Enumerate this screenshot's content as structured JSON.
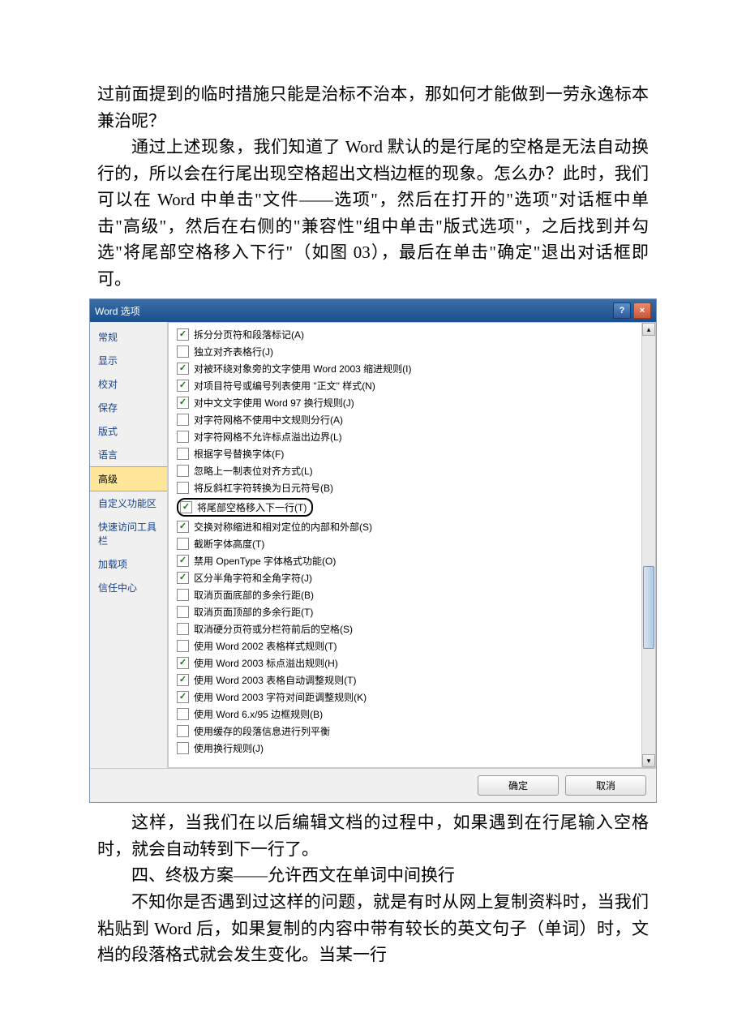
{
  "doc": {
    "para1": "过前面提到的临时措施只能是治标不治本，那如何才能做到一劳永逸标本兼治呢？",
    "para2": "通过上述现象，我们知道了 Word 默认的是行尾的空格是无法自动换行的，所以会在行尾出现空格超出文档边框的现象。怎么办？此时，我们可以在 Word 中单击\"文件——选项\"，然后在打开的\"选项\"对话框中单击\"高级\"，然后在右侧的\"兼容性\"组中单击\"版式选项\"，之后找到并勾选\"将尾部空格移入下行\"（如图 03），最后在单击\"确定\"退出对话框即可。",
    "para3": "这样，当我们在以后编辑文档的过程中，如果遇到在行尾输入空格时，就会自动转到下一行了。",
    "heading4": "四、终极方案——允许西文在单词中间换行",
    "para4": "不知你是否遇到过这样的问题，就是有时从网上复制资料时，当我们粘贴到 Word 后，如果复制的内容中带有较长的英文句子（单词）时，文档的段落格式就会发生变化。当某一行"
  },
  "dialog": {
    "title": "Word 选项",
    "help": "?",
    "close": "×",
    "sidebar": [
      "常规",
      "显示",
      "校对",
      "保存",
      "版式",
      "语言",
      "高级",
      "自定义功能区",
      "快速访问工具栏",
      "加载项",
      "信任中心"
    ],
    "selected_index": 6,
    "options": [
      {
        "checked": true,
        "label": "拆分分页符和段落标记(A)"
      },
      {
        "checked": false,
        "label": "独立对齐表格行(J)"
      },
      {
        "checked": true,
        "label": "对被环绕对象旁的文字使用 Word 2003 缩进规则(I)"
      },
      {
        "checked": true,
        "label": "对项目符号或编号列表使用 \"正文\" 样式(N)"
      },
      {
        "checked": true,
        "label": "对中文文字使用 Word 97 换行规则(J)"
      },
      {
        "checked": false,
        "label": "对字符网格不使用中文规则分行(A)"
      },
      {
        "checked": false,
        "label": "对字符网格不允许标点溢出边界(L)"
      },
      {
        "checked": false,
        "label": "根据字号替换字体(F)"
      },
      {
        "checked": false,
        "label": "忽略上一制表位对齐方式(L)"
      },
      {
        "checked": false,
        "label": "将反斜杠字符转换为日元符号(B)"
      },
      {
        "checked": true,
        "label": "将尾部空格移入下一行(T)",
        "highlight": true
      },
      {
        "checked": true,
        "label": "交换对称缩进和相对定位的内部和外部(S)"
      },
      {
        "checked": false,
        "label": "截断字体高度(T)"
      },
      {
        "checked": true,
        "label": "禁用 OpenType 字体格式功能(O)"
      },
      {
        "checked": true,
        "label": "区分半角字符和全角字符(J)"
      },
      {
        "checked": false,
        "label": "取消页面底部的多余行距(B)"
      },
      {
        "checked": false,
        "label": "取消页面顶部的多余行距(T)"
      },
      {
        "checked": false,
        "label": "取消硬分页符或分栏符前后的空格(S)"
      },
      {
        "checked": false,
        "label": "使用 Word 2002 表格样式规则(T)"
      },
      {
        "checked": true,
        "label": "使用 Word 2003 标点溢出规则(H)"
      },
      {
        "checked": true,
        "label": "使用 Word 2003 表格自动调整规则(T)"
      },
      {
        "checked": true,
        "label": "使用 Word 2003 字符对间距调整规则(K)"
      },
      {
        "checked": false,
        "label": "使用 Word 6.x/95 边框规则(B)"
      },
      {
        "checked": false,
        "label": "使用缓存的段落信息进行列平衡"
      },
      {
        "checked": false,
        "label": "使用换行规则(J)"
      }
    ],
    "ok_label": "确定",
    "cancel_label": "取消"
  }
}
